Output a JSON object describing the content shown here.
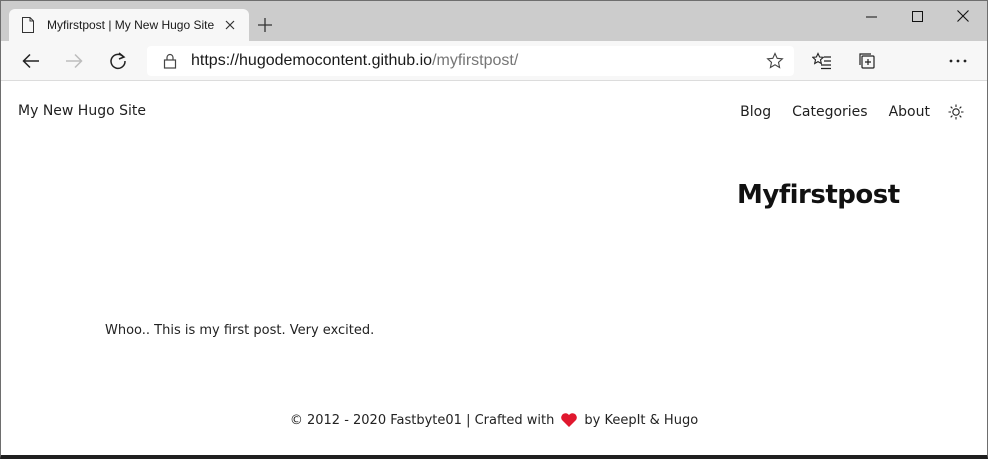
{
  "browser": {
    "tab_title": "Myfirstpost | My New Hugo Site",
    "url_host": "https://hugodemocontent.github.io",
    "url_path": "/myfirstpost/"
  },
  "site": {
    "title": "My New Hugo Site",
    "nav": [
      "Blog",
      "Categories",
      "About"
    ]
  },
  "post": {
    "title": "Myfirstpost",
    "body": "Whoo.. This is my first post. Very excited."
  },
  "footer": {
    "prefix": "© 2012 - 2020 Fastbyte01 | Crafted with",
    "suffix": "by KeepIt & Hugo",
    "heart_color": "#e0182e"
  }
}
